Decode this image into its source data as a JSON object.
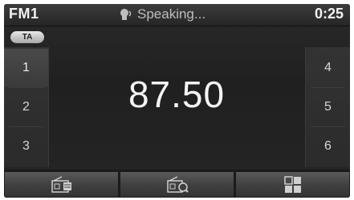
{
  "status_bar": {
    "band": "FM1",
    "status_text": "Speaking...",
    "status_icon": "speaking-icon",
    "clock": "0:25"
  },
  "ta_badge": "TA",
  "presets": {
    "left": [
      "1",
      "2",
      "3"
    ],
    "right": [
      "4",
      "5",
      "6"
    ],
    "selected": "1"
  },
  "frequency": "87.50",
  "bottom_bar": {
    "buttons": [
      {
        "icon": "radio-list-icon"
      },
      {
        "icon": "radio-scan-icon"
      },
      {
        "icon": "grid-menu-icon"
      }
    ]
  },
  "colors": {
    "screen_bg": "#222222",
    "text": "#f5f5f5",
    "button": "#4a4a4a"
  }
}
